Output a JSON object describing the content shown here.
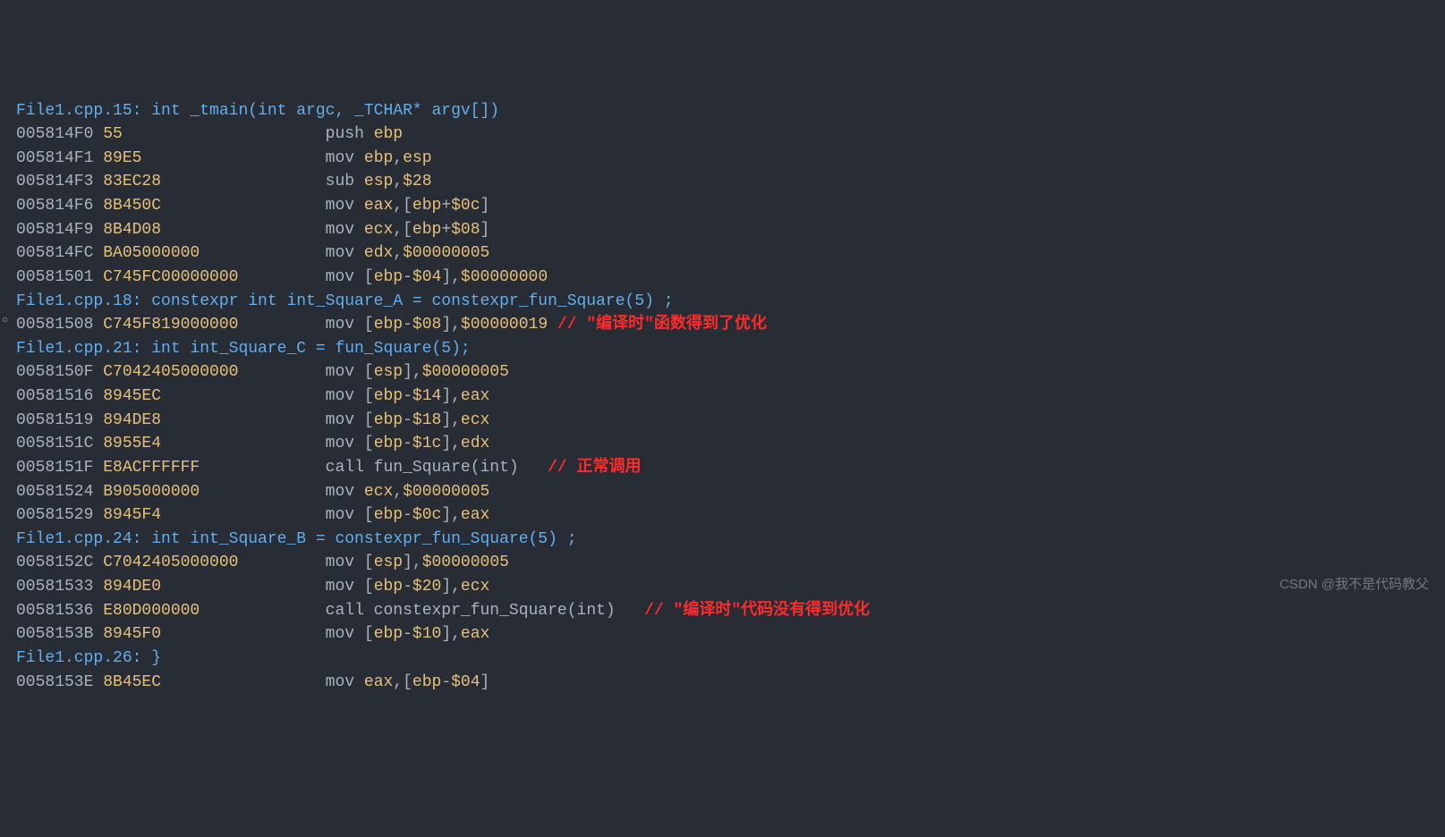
{
  "lines": [
    {
      "type": "src",
      "text": "File1.cpp.15: int _tmain(int argc, _TCHAR* argv[])"
    },
    {
      "type": "asm",
      "addr": "005814F0",
      "hex": "55",
      "pad": 23,
      "instr": [
        [
          "",
          "push "
        ],
        [
          "reg",
          "ebp"
        ]
      ]
    },
    {
      "type": "asm",
      "addr": "005814F1",
      "hex": "89E5",
      "pad": 23,
      "instr": [
        [
          "",
          "mov "
        ],
        [
          "reg",
          "ebp"
        ],
        [
          "",
          ","
        ],
        [
          "reg",
          "esp"
        ]
      ]
    },
    {
      "type": "asm",
      "addr": "005814F3",
      "hex": "83EC28",
      "pad": 23,
      "instr": [
        [
          "",
          "sub "
        ],
        [
          "reg",
          "esp"
        ],
        [
          "",
          ","
        ],
        [
          "num",
          "$28"
        ]
      ]
    },
    {
      "type": "asm",
      "addr": "005814F6",
      "hex": "8B450C",
      "pad": 23,
      "instr": [
        [
          "",
          "mov "
        ],
        [
          "reg",
          "eax"
        ],
        [
          "",
          ",["
        ],
        [
          "reg",
          "ebp"
        ],
        [
          "",
          "+"
        ],
        [
          "num",
          "$0c"
        ],
        [
          "",
          "]"
        ]
      ]
    },
    {
      "type": "asm",
      "addr": "005814F9",
      "hex": "8B4D08",
      "pad": 23,
      "instr": [
        [
          "",
          "mov "
        ],
        [
          "reg",
          "ecx"
        ],
        [
          "",
          ",["
        ],
        [
          "reg",
          "ebp"
        ],
        [
          "",
          "+"
        ],
        [
          "num",
          "$08"
        ],
        [
          "",
          "]"
        ]
      ]
    },
    {
      "type": "asm",
      "addr": "005814FC",
      "hex": "BA05000000",
      "pad": 23,
      "instr": [
        [
          "",
          "mov "
        ],
        [
          "reg",
          "edx"
        ],
        [
          "",
          ","
        ],
        [
          "num",
          "$00000005"
        ]
      ]
    },
    {
      "type": "asm",
      "addr": "00581501",
      "hex": "C745FC00000000",
      "pad": 23,
      "instr": [
        [
          "",
          "mov ["
        ],
        [
          "reg",
          "ebp"
        ],
        [
          "",
          "-"
        ],
        [
          "num",
          "$04"
        ],
        [
          "",
          "],"
        ],
        [
          "num",
          "$00000000"
        ]
      ]
    },
    {
      "type": "src",
      "text": "File1.cpp.18: constexpr int int_Square_A = constexpr_fun_Square(5) ;"
    },
    {
      "type": "asm",
      "bp": true,
      "addr": "00581508",
      "hex": "C745F819000000",
      "pad": 23,
      "instr": [
        [
          "",
          "mov ["
        ],
        [
          "reg",
          "ebp"
        ],
        [
          "",
          "-"
        ],
        [
          "num",
          "$08"
        ],
        [
          "",
          "],"
        ],
        [
          "num",
          "$00000019"
        ]
      ],
      "comment": " // \"编译时\"函数得到了优化"
    },
    {
      "type": "src",
      "text": "File1.cpp.21: int int_Square_C = fun_Square(5);"
    },
    {
      "type": "asm",
      "addr": "0058150F",
      "hex": "C7042405000000",
      "pad": 23,
      "instr": [
        [
          "",
          "mov ["
        ],
        [
          "reg",
          "esp"
        ],
        [
          "",
          "],"
        ],
        [
          "num",
          "$00000005"
        ]
      ]
    },
    {
      "type": "asm",
      "addr": "00581516",
      "hex": "8945EC",
      "pad": 23,
      "instr": [
        [
          "",
          "mov ["
        ],
        [
          "reg",
          "ebp"
        ],
        [
          "",
          "-"
        ],
        [
          "num",
          "$14"
        ],
        [
          "",
          "],"
        ],
        [
          "reg",
          "eax"
        ]
      ]
    },
    {
      "type": "asm",
      "addr": "00581519",
      "hex": "894DE8",
      "pad": 23,
      "instr": [
        [
          "",
          "mov ["
        ],
        [
          "reg",
          "ebp"
        ],
        [
          "",
          "-"
        ],
        [
          "num",
          "$18"
        ],
        [
          "",
          "],"
        ],
        [
          "reg",
          "ecx"
        ]
      ]
    },
    {
      "type": "asm",
      "addr": "0058151C",
      "hex": "8955E4",
      "pad": 23,
      "instr": [
        [
          "",
          "mov ["
        ],
        [
          "reg",
          "ebp"
        ],
        [
          "",
          "-"
        ],
        [
          "num",
          "$1c"
        ],
        [
          "",
          "],"
        ],
        [
          "reg",
          "edx"
        ]
      ]
    },
    {
      "type": "asm",
      "addr": "0058151F",
      "hex": "E8ACFFFFFF",
      "pad": 23,
      "instr": [
        [
          "",
          "call fun_Square(int)"
        ]
      ],
      "comment": "   // 正常调用"
    },
    {
      "type": "asm",
      "addr": "00581524",
      "hex": "B905000000",
      "pad": 23,
      "instr": [
        [
          "",
          "mov "
        ],
        [
          "reg",
          "ecx"
        ],
        [
          "",
          ","
        ],
        [
          "num",
          "$00000005"
        ]
      ]
    },
    {
      "type": "asm",
      "addr": "00581529",
      "hex": "8945F4",
      "pad": 23,
      "instr": [
        [
          "",
          "mov ["
        ],
        [
          "reg",
          "ebp"
        ],
        [
          "",
          "-"
        ],
        [
          "num",
          "$0c"
        ],
        [
          "",
          "],"
        ],
        [
          "reg",
          "eax"
        ]
      ]
    },
    {
      "type": "src",
      "text": "File1.cpp.24: int int_Square_B = constexpr_fun_Square(5) ;"
    },
    {
      "type": "asm",
      "addr": "0058152C",
      "hex": "C7042405000000",
      "pad": 23,
      "instr": [
        [
          "",
          "mov ["
        ],
        [
          "reg",
          "esp"
        ],
        [
          "",
          "],"
        ],
        [
          "num",
          "$00000005"
        ]
      ]
    },
    {
      "type": "asm",
      "addr": "00581533",
      "hex": "894DE0",
      "pad": 23,
      "instr": [
        [
          "",
          "mov ["
        ],
        [
          "reg",
          "ebp"
        ],
        [
          "",
          "-"
        ],
        [
          "num",
          "$20"
        ],
        [
          "",
          "],"
        ],
        [
          "reg",
          "ecx"
        ]
      ]
    },
    {
      "type": "asm",
      "addr": "00581536",
      "hex": "E80D000000",
      "pad": 23,
      "instr": [
        [
          "",
          "call constexpr_fun_Square(int)"
        ]
      ],
      "comment": "   // \"编译时\"代码没有得到优化"
    },
    {
      "type": "asm",
      "addr": "0058153B",
      "hex": "8945F0",
      "pad": 23,
      "instr": [
        [
          "",
          "mov ["
        ],
        [
          "reg",
          "ebp"
        ],
        [
          "",
          "-"
        ],
        [
          "num",
          "$10"
        ],
        [
          "",
          "],"
        ],
        [
          "reg",
          "eax"
        ]
      ]
    },
    {
      "type": "src",
      "text": "File1.cpp.26: }"
    },
    {
      "type": "asm",
      "addr": "0058153E",
      "hex": "8B45EC",
      "pad": 23,
      "instr": [
        [
          "",
          "mov "
        ],
        [
          "reg",
          "eax"
        ],
        [
          "",
          ",["
        ],
        [
          "reg",
          "ebp"
        ],
        [
          "",
          "-"
        ],
        [
          "num",
          "$04"
        ],
        [
          "",
          "]"
        ]
      ]
    }
  ],
  "watermark": "CSDN @我不是代码教父"
}
